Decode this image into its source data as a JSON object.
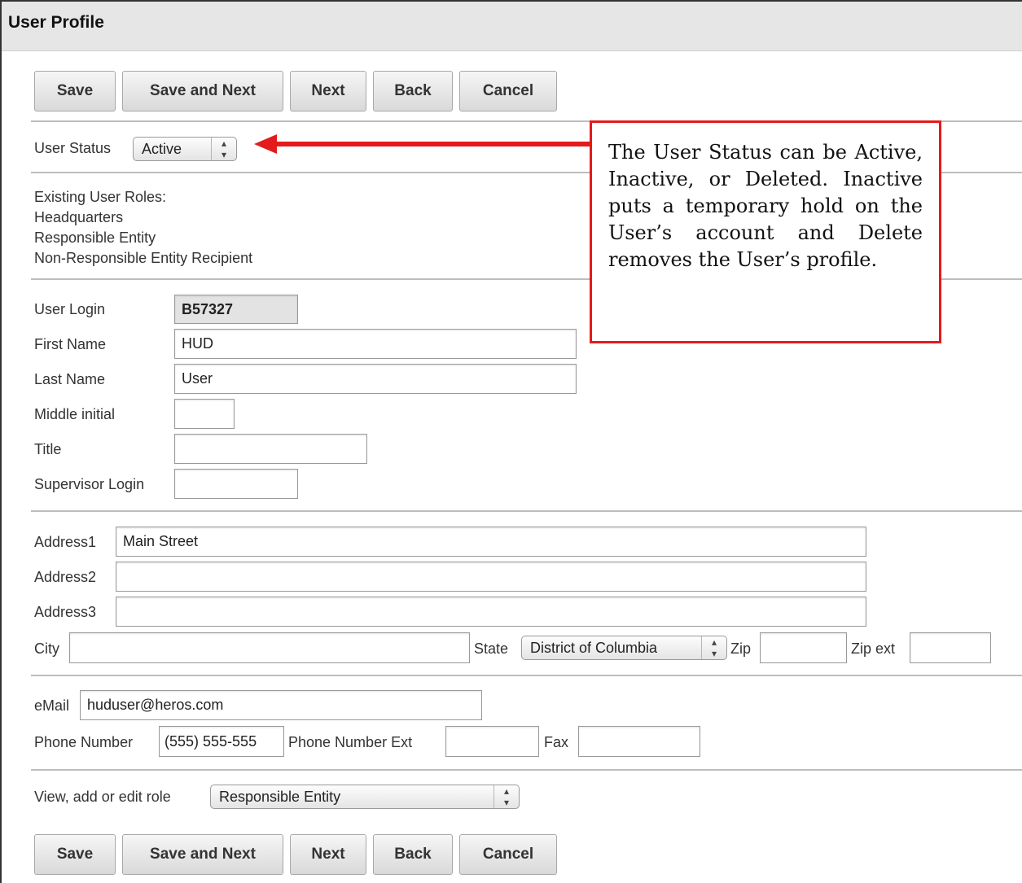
{
  "header": {
    "title": "User Profile"
  },
  "toolbar": {
    "buttons": [
      "Save",
      "Save and Next",
      "Next",
      "Back",
      "Cancel"
    ]
  },
  "user_status": {
    "label": "User Status",
    "value": "Active"
  },
  "roles": {
    "heading": "Existing User Roles:",
    "items": [
      "Headquarters",
      "Responsible Entity",
      "Non-Responsible Entity Recipient"
    ]
  },
  "identity": {
    "login_label": "User Login",
    "login_value": "B57327",
    "first_label": "First Name",
    "first_value": "HUD",
    "last_label": "Last Name",
    "last_value": "User",
    "middle_label": "Middle initial",
    "middle_value": "",
    "title_label": "Title",
    "title_value": "",
    "supervisor_label": "Supervisor Login",
    "supervisor_value": ""
  },
  "address": {
    "address1_label": "Address1",
    "address1_value": "Main Street",
    "address2_label": "Address2",
    "address2_value": "",
    "address3_label": "Address3",
    "address3_value": "",
    "city_label": "City",
    "city_value": "",
    "state_label": "State",
    "state_value": "District of Columbia",
    "zip_label": "Zip",
    "zip_value": "",
    "zipext_label": "Zip ext",
    "zipext_value": ""
  },
  "contact": {
    "email_label": "eMail",
    "email_value": "huduser@heros.com",
    "phone_label": "Phone Number",
    "phone_value": "(555) 555-555",
    "phoneext_label": "Phone Number Ext",
    "phoneext_value": "",
    "fax_label": "Fax",
    "fax_value": ""
  },
  "role_select": {
    "label": "View, add or edit role",
    "value": "Responsible Entity"
  },
  "callout": {
    "text": "The User Status can be Active, Inactive, or Deleted. Inactive puts a temporary hold on the User’s account and Delete removes the User’s profile."
  },
  "colors": {
    "callout_border": "#e31b1b",
    "arrow": "#e31b1b",
    "titlebar_bg": "#e6e6e6"
  }
}
